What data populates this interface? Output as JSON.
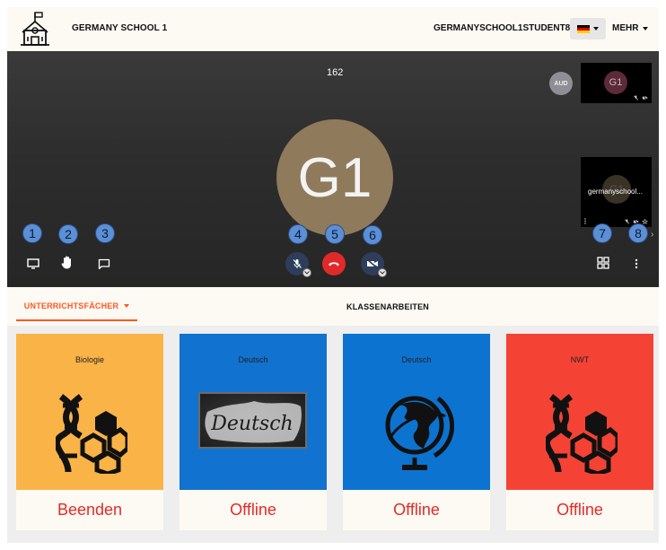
{
  "header": {
    "school_name": "GERMANY SCHOOL 1",
    "user_name": "GERMANYSCHOOL1STUDENT8",
    "more_label": "MEHR",
    "language_flag": "de-flag"
  },
  "stage": {
    "participant_count": "162",
    "main_avatar_initials": "G1",
    "aud_badge": "AUD",
    "thumbnails": [
      {
        "initials": "G1"
      },
      {
        "initials": "G1",
        "name": "germanyschool..."
      }
    ],
    "annotation_numbers": [
      "1",
      "2",
      "3",
      "4",
      "5",
      "6",
      "7",
      "8"
    ],
    "controls": {
      "left": [
        "screen-share-icon",
        "raise-hand-icon",
        "chat-icon"
      ],
      "center": [
        "mic-muted-icon",
        "hangup-icon",
        "camera-off-icon"
      ],
      "right": [
        "grid-layout-icon",
        "more-vertical-icon"
      ]
    }
  },
  "tabs": {
    "active_label": "UNTERRICHTSFÄCHER",
    "second_label": "KLASSENARBEITEN"
  },
  "cards": [
    {
      "subject": "Biologie",
      "status": "Beenden",
      "color": "#f9b347",
      "icon": "dna-icon"
    },
    {
      "subject": "Deutsch",
      "status": "Offline",
      "color": "#1172cf",
      "icon": "chalkboard-image"
    },
    {
      "subject": "Deutsch",
      "status": "Offline",
      "color": "#0d73d1",
      "icon": "globe-icon"
    },
    {
      "subject": "NWT",
      "status": "Offline",
      "color": "#f44334",
      "icon": "dna-icon"
    }
  ],
  "chalkboard_text": "Deutsch",
  "colors": {
    "accent": "#ff5722",
    "status_red": "#e32b27",
    "badge_blue": "#5b8fd6"
  }
}
